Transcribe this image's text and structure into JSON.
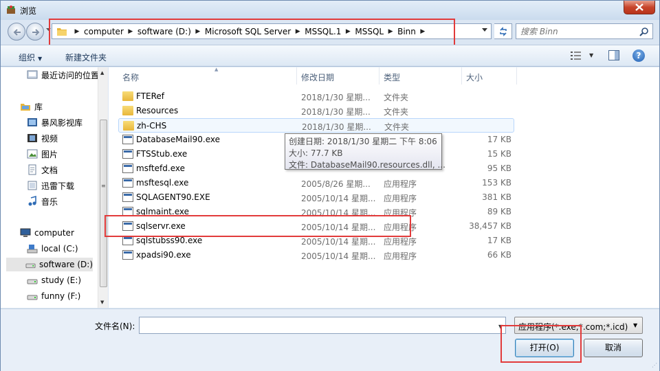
{
  "window": {
    "title": "浏览",
    "close_icon": "close-icon"
  },
  "nav": {
    "back_icon": "back-arrow-icon",
    "forward_icon": "forward-arrow-icon"
  },
  "address": {
    "crumbs": [
      "computer",
      "software (D:)",
      "Microsoft SQL Server",
      "MSSQL.1",
      "MSSQL",
      "Binn"
    ]
  },
  "search": {
    "placeholder": "搜索 Binn"
  },
  "toolbar": {
    "organize_label": "组织",
    "new_folder_label": "新建文件夹"
  },
  "navpane": {
    "recent": "最近访问的位置",
    "libraries": "库",
    "lib_items": [
      "暴风影视库",
      "视频",
      "图片",
      "文档",
      "迅雷下载",
      "音乐"
    ],
    "computer": "computer",
    "drives": [
      "local (C:)",
      "software (D:)",
      "study (E:)",
      "funny (F:)"
    ],
    "selected_drive": "software (D:)"
  },
  "columns": {
    "name": "名称",
    "date": "修改日期",
    "type": "类型",
    "size": "大小"
  },
  "files": [
    {
      "name": "FTERef",
      "date": "2018/1/30 星期...",
      "type": "文件夹",
      "size": "",
      "kind": "folder"
    },
    {
      "name": "Resources",
      "date": "2018/1/30 星期...",
      "type": "文件夹",
      "size": "",
      "kind": "folder"
    },
    {
      "name": "zh-CHS",
      "date": "2018/1/30 星期...",
      "type": "文件夹",
      "size": "",
      "kind": "folder",
      "hover": true
    },
    {
      "name": "DatabaseMail90.exe",
      "date": "",
      "type": "",
      "size": "17 KB",
      "kind": "exe"
    },
    {
      "name": "FTSStub.exe",
      "date": "",
      "type": "",
      "size": "15 KB",
      "kind": "exe"
    },
    {
      "name": "msftefd.exe",
      "date": "",
      "type": "",
      "size": "95 KB",
      "kind": "exe"
    },
    {
      "name": "msftesql.exe",
      "date": "2005/8/26 星期...",
      "type": "应用程序",
      "size": "153 KB",
      "kind": "exe"
    },
    {
      "name": "SQLAGENT90.EXE",
      "date": "2005/10/14 星期...",
      "type": "应用程序",
      "size": "381 KB",
      "kind": "exe"
    },
    {
      "name": "sqlmaint.exe",
      "date": "2005/10/14 星期...",
      "type": "应用程序",
      "size": "89 KB",
      "kind": "exe"
    },
    {
      "name": "sqlservr.exe",
      "date": "2005/10/14 星期...",
      "type": "应用程序",
      "size": "38,457 KB",
      "kind": "exe"
    },
    {
      "name": "sqlstubss90.exe",
      "date": "2005/10/14 星期...",
      "type": "应用程序",
      "size": "17 KB",
      "kind": "exe"
    },
    {
      "name": "xpadsi90.exe",
      "date": "2005/10/14 星期...",
      "type": "应用程序",
      "size": "66 KB",
      "kind": "exe"
    }
  ],
  "tooltip": {
    "created": "创建日期: 2018/1/30 星期二 下午 8:06",
    "size": "大小: 77.7 KB",
    "files": "文件: DatabaseMail90.resources.dll, ..."
  },
  "bottom": {
    "filename_label": "文件名(N):",
    "filename_value": "",
    "filter_value": "应用程序(*.exe;*.com;*.icd)",
    "open_label": "打开(O)",
    "cancel_label": "取消"
  },
  "highlight_color": "#e23a3a"
}
